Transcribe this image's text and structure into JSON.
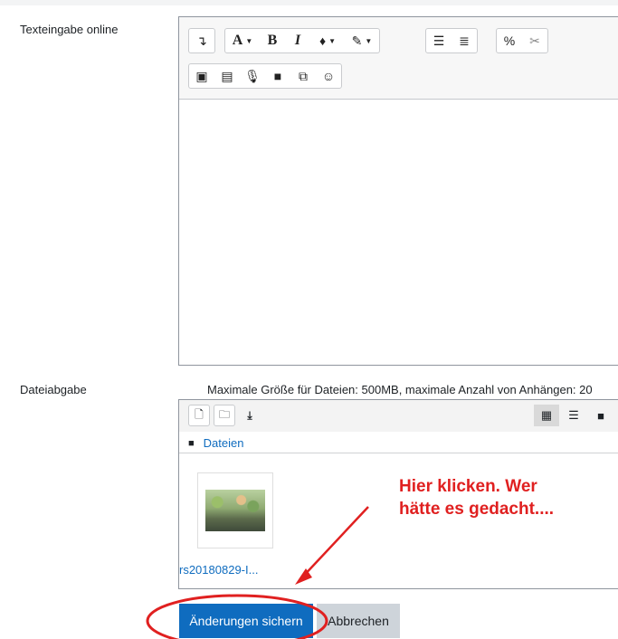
{
  "labels": {
    "online_text": "Texteingabe online",
    "file_submission": "Dateiabgabe"
  },
  "editor": {
    "toolbar_row1": [
      {
        "icon": "collapse-toggle-icon",
        "glyph": "↴"
      },
      {
        "icon": "font-style-icon",
        "glyph": "A"
      },
      {
        "icon": "bold-icon",
        "glyph": "B"
      },
      {
        "icon": "italic-icon",
        "glyph": "I"
      },
      {
        "icon": "font-color-icon",
        "glyph": "♦"
      },
      {
        "icon": "background-color-icon",
        "glyph": "✎"
      },
      {
        "icon": "unordered-list-icon",
        "glyph": "☰"
      },
      {
        "icon": "ordered-list-icon",
        "glyph": "≣"
      },
      {
        "icon": "link-icon",
        "glyph": "%"
      },
      {
        "icon": "unlink-icon",
        "glyph": "✂"
      }
    ],
    "toolbar_row2": [
      {
        "icon": "insert-image-icon",
        "glyph": "▣"
      },
      {
        "icon": "insert-media-icon",
        "glyph": "▤"
      },
      {
        "icon": "record-audio-icon",
        "glyph": "🎙"
      },
      {
        "icon": "record-video-icon",
        "glyph": "■"
      },
      {
        "icon": "manage-files-icon",
        "glyph": "⧉"
      },
      {
        "icon": "emoticon-icon",
        "glyph": "☺"
      }
    ]
  },
  "filepicker": {
    "max_info": "Maximale Größe für Dateien: 500MB, maximale Anzahl von Anhängen: 20",
    "breadcrumb": "Dateien",
    "file_name": "rs20180829-I...",
    "icons": {
      "add": "add-file-icon",
      "folder": "create-folder-icon",
      "download": "download-icon",
      "grid": "grid-view-icon",
      "list": "list-view-icon",
      "tree": "tree-view-icon"
    }
  },
  "buttons": {
    "save": "Änderungen sichern",
    "cancel": "Abbrechen"
  },
  "annotation": {
    "text": "Hier klicken. Wer\nhätte es gedacht....",
    "color": "#e02020"
  },
  "colors": {
    "primary": "#0f6cbf",
    "secondary": "#ced4da"
  }
}
